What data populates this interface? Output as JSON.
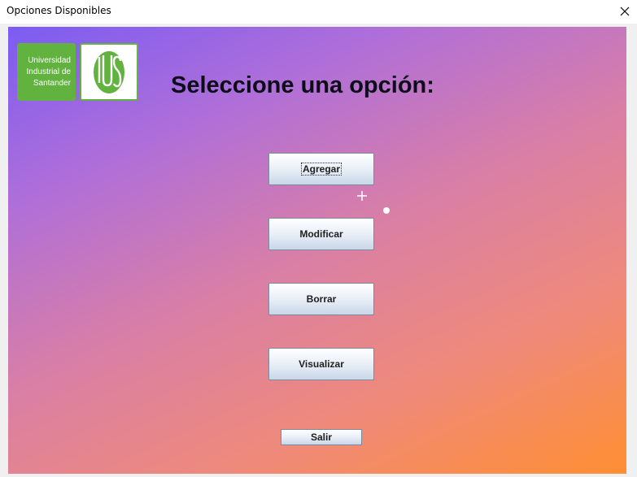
{
  "window": {
    "title": "Opciones Disponibles",
    "close_icon": "close-icon"
  },
  "logo": {
    "line1": "Universidad",
    "line2": "Industrial de",
    "line3": "Santander",
    "symbol_icon": "uis-symbol-icon",
    "brand_color": "#61b23e"
  },
  "heading": "Seleccione una opción:",
  "buttons": {
    "agregar": "Agregar",
    "modificar": "Modificar",
    "borrar": "Borrar",
    "visualizar": "Visualizar",
    "salir": "Salir"
  },
  "colors": {
    "gradient_start": "#7b5cf2",
    "gradient_end": "#ff8f33"
  }
}
